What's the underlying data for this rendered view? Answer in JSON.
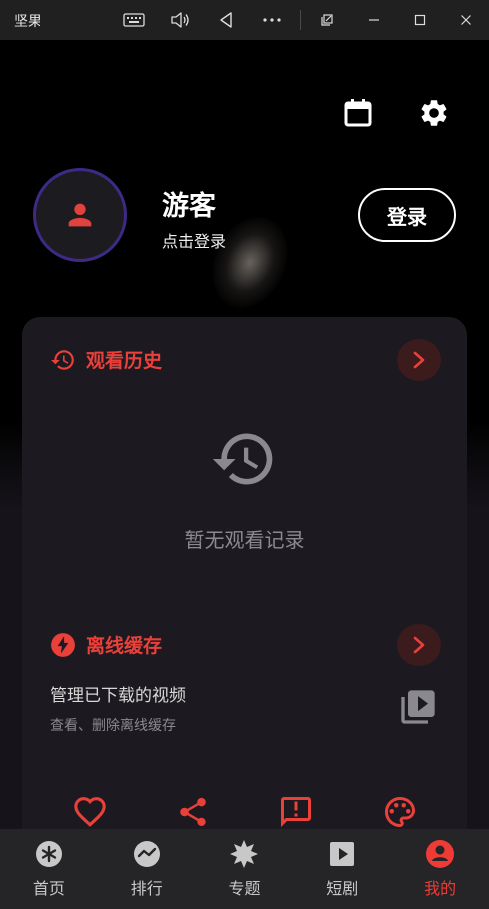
{
  "window": {
    "title": "坚果",
    "buttons": [
      "keyboard-icon",
      "volume-icon",
      "back-icon",
      "more-icon",
      "restore-icon",
      "minimize-icon",
      "maximize-icon",
      "close-icon"
    ]
  },
  "header": {
    "icons": [
      "calendar-icon",
      "settings-icon"
    ]
  },
  "profile": {
    "name": "游客",
    "hint": "点击登录",
    "login_label": "登录"
  },
  "history": {
    "title": "观看历史",
    "empty_text": "暂无观看记录"
  },
  "offline": {
    "title": "离线缓存",
    "manage_title": "管理已下载的视频",
    "manage_sub": "查看、删除离线缓存"
  },
  "actions": [
    "favorite-icon",
    "share-icon",
    "feedback-icon",
    "theme-icon"
  ],
  "nav": {
    "items": [
      {
        "label": "首页",
        "icon": "asterisk-icon"
      },
      {
        "label": "排行",
        "icon": "trend-icon"
      },
      {
        "label": "专题",
        "icon": "burst-icon"
      },
      {
        "label": "短剧",
        "icon": "play-icon"
      },
      {
        "label": "我的",
        "icon": "person-icon"
      }
    ],
    "active": "我的"
  },
  "colors": {
    "accent": "#e9403a",
    "avatar_ring": "#3e2a86",
    "card": "#1c1a20",
    "nav_bg": "#252528"
  }
}
